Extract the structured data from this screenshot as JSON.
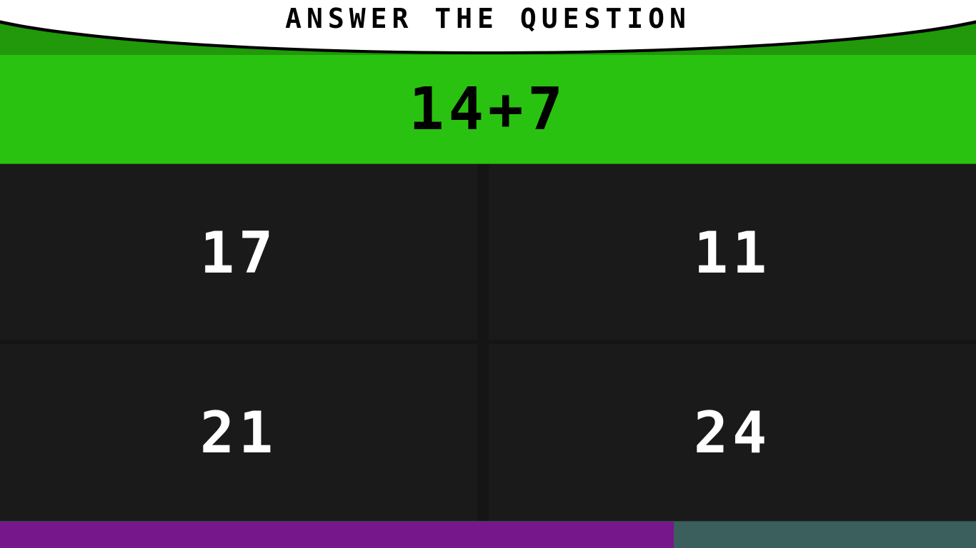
{
  "header": {
    "title": "ANSWER THE QUESTION"
  },
  "question": {
    "text": "14+7"
  },
  "answers": [
    {
      "label": "17"
    },
    {
      "label": "11"
    },
    {
      "label": "21"
    },
    {
      "label": "24"
    }
  ],
  "timer": {
    "remaining_fraction": 0.69,
    "fill_color": "#76178b",
    "track_color": "#3b5f5c"
  },
  "colors": {
    "header_green": "#21990a",
    "question_green": "#2ac211",
    "answer_tile": "#1a1a1a"
  }
}
